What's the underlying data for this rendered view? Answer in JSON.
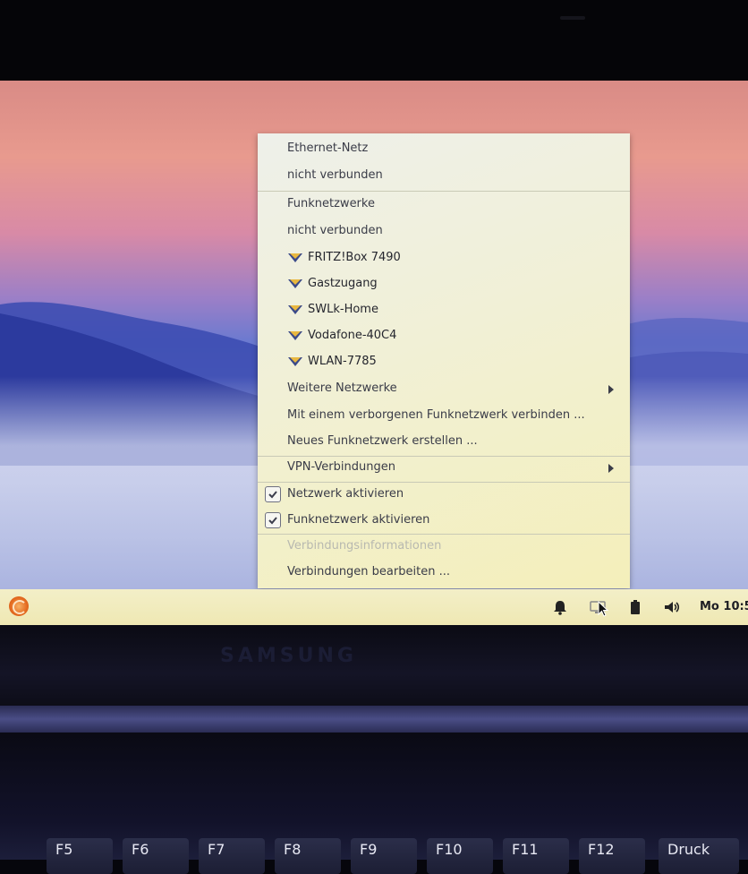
{
  "menu": {
    "ethernet_header": "Ethernet-Netz",
    "ethernet_status": "nicht verbunden",
    "wifi_header": "Funknetzwerke",
    "wifi_status": "nicht verbunden",
    "networks": [
      "FRITZ!Box 7490",
      "Gastzugang",
      "SWLk-Home",
      "Vodafone-40C4",
      "WLAN-7785"
    ],
    "more_networks": "Weitere Netzwerke",
    "connect_hidden": "Mit einem verborgenen Funknetzwerk verbinden ...",
    "create_new": "Neues Funknetzwerk erstellen ...",
    "vpn": "VPN-Verbindungen",
    "enable_network": "Netzwerk aktivieren",
    "enable_network_checked": true,
    "enable_wifi": "Funknetzwerk aktivieren",
    "enable_wifi_checked": true,
    "connection_info": "Verbindungsinformationen",
    "edit_connections": "Verbindungen bearbeiten ..."
  },
  "taskbar": {
    "clock": "Mo 10:5",
    "icons": [
      "app-menu-logo-icon",
      "notification-bell-icon",
      "network-monitor-icon",
      "battery-icon",
      "volume-icon"
    ]
  },
  "laptop": {
    "brand": "SAMSUNG",
    "keys": [
      "F5",
      "F6",
      "F7",
      "F8",
      "F9",
      "F10",
      "F11",
      "F12",
      "Druck"
    ]
  },
  "colors": {
    "menu_bg": "#f1f0d6",
    "taskbar_bg": "#f3efc8",
    "logo": "#e46a1f",
    "text": "#3a3c48"
  }
}
